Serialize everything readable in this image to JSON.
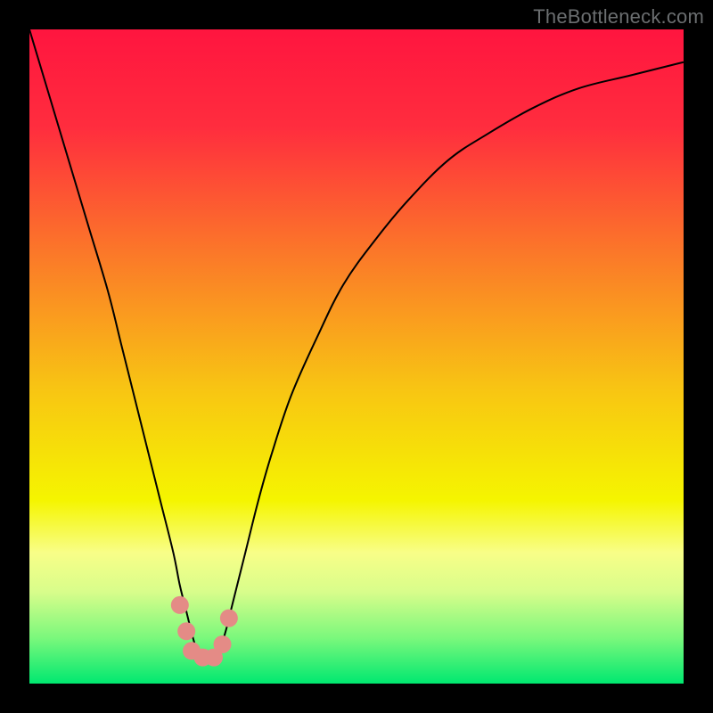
{
  "watermark": "TheBottleneck.com",
  "chart_data": {
    "type": "line",
    "title": "",
    "xlabel": "",
    "ylabel": "",
    "xlim": [
      0,
      100
    ],
    "ylim": [
      0,
      100
    ],
    "grid": false,
    "legend": false,
    "background_gradient": {
      "stops": [
        {
          "offset": 0.0,
          "color": "#ff153f"
        },
        {
          "offset": 0.15,
          "color": "#ff2d3e"
        },
        {
          "offset": 0.35,
          "color": "#fb7b28"
        },
        {
          "offset": 0.55,
          "color": "#f8c513"
        },
        {
          "offset": 0.72,
          "color": "#f5f500"
        },
        {
          "offset": 0.8,
          "color": "#f8fe88"
        },
        {
          "offset": 0.86,
          "color": "#d8fd8b"
        },
        {
          "offset": 0.93,
          "color": "#7bf87c"
        },
        {
          "offset": 1.0,
          "color": "#00e870"
        }
      ]
    },
    "series": [
      {
        "name": "bottleneck-curve",
        "color": "#000000",
        "width": 2,
        "x": [
          0,
          3,
          6,
          9,
          12,
          14,
          16,
          18,
          20,
          22,
          23,
          24,
          25,
          26,
          27,
          28,
          29,
          30,
          31,
          33,
          35,
          37,
          40,
          44,
          48,
          53,
          58,
          64,
          70,
          77,
          84,
          92,
          100
        ],
        "y": [
          100,
          90,
          80,
          70,
          60,
          52,
          44,
          36,
          28,
          20,
          15,
          11,
          7,
          4,
          4,
          4,
          5,
          8,
          12,
          20,
          28,
          35,
          44,
          53,
          61,
          68,
          74,
          80,
          84,
          88,
          91,
          93,
          95
        ]
      }
    ],
    "markers": {
      "name": "highlight-dots",
      "color": "#e48b86",
      "radius": 10,
      "points": [
        {
          "x": 23.0,
          "y": 12
        },
        {
          "x": 24.0,
          "y": 8
        },
        {
          "x": 24.8,
          "y": 5
        },
        {
          "x": 26.5,
          "y": 4
        },
        {
          "x": 28.2,
          "y": 4
        },
        {
          "x": 29.5,
          "y": 6
        },
        {
          "x": 30.5,
          "y": 10
        }
      ]
    }
  }
}
